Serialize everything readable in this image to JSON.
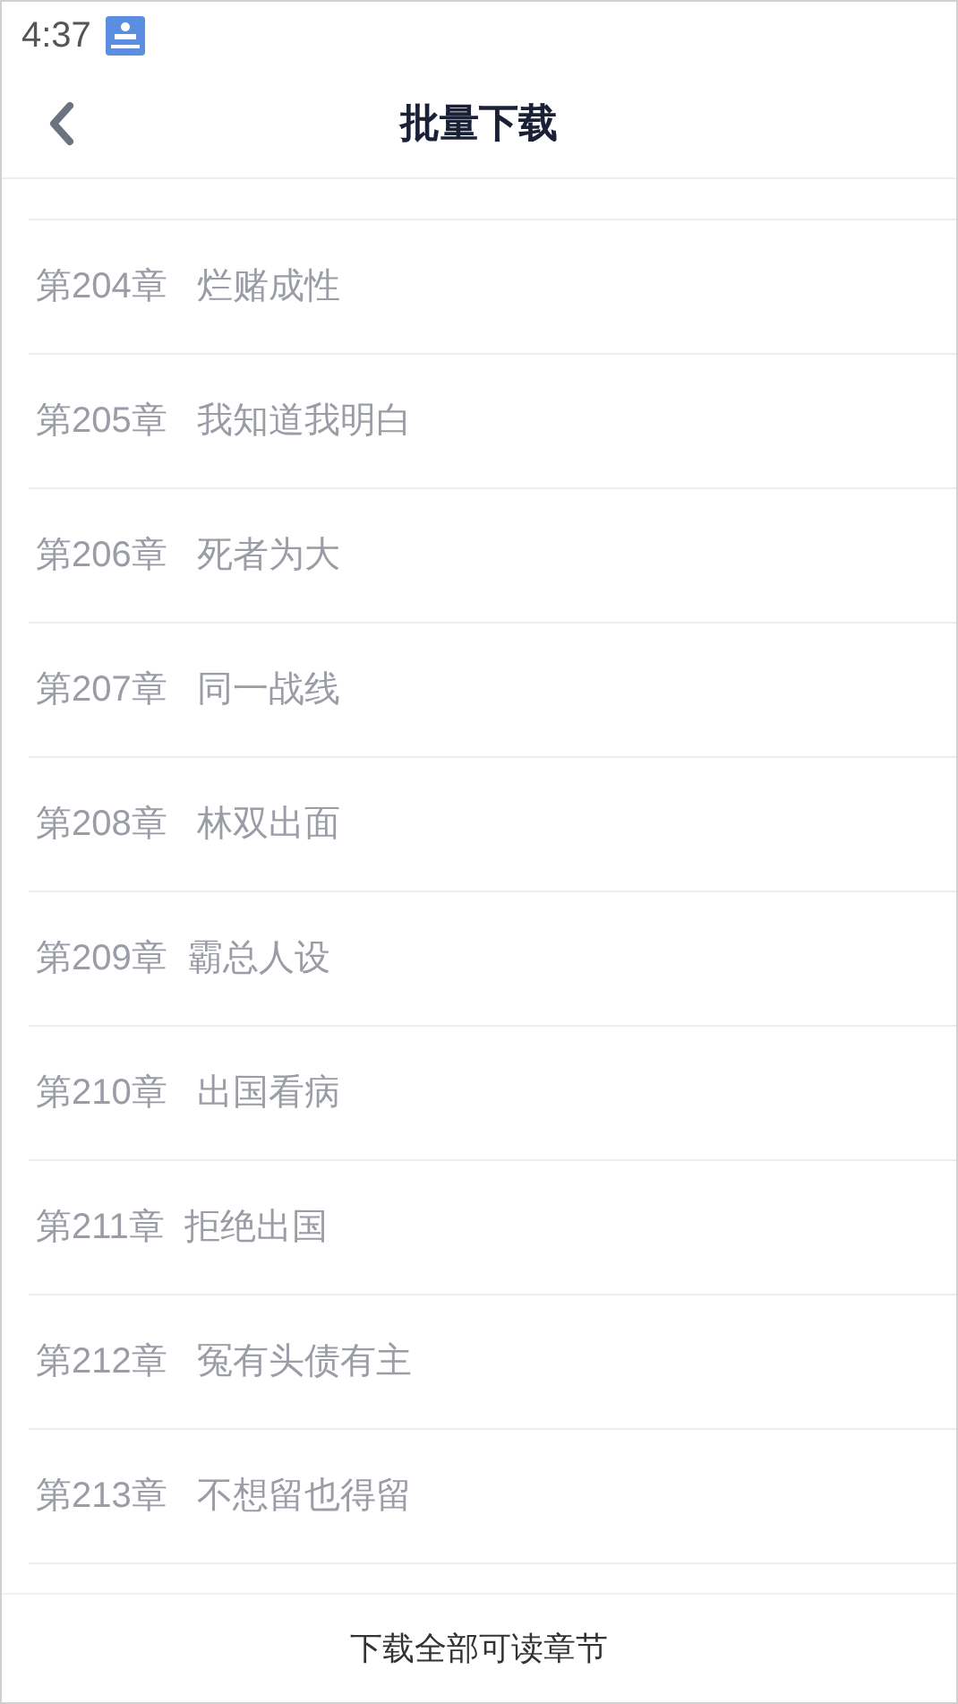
{
  "status_bar": {
    "time": "4:37"
  },
  "header": {
    "title": "批量下载"
  },
  "chapters": [
    {
      "text": "第204章   烂赌成性"
    },
    {
      "text": "第205章   我知道我明白"
    },
    {
      "text": "第206章   死者为大"
    },
    {
      "text": "第207章   同一战线"
    },
    {
      "text": "第208章   林双出面"
    },
    {
      "text": "第209章  霸总人设"
    },
    {
      "text": "第210章   出国看病"
    },
    {
      "text": "第211章  拒绝出国"
    },
    {
      "text": "第212章   冤有头债有主"
    },
    {
      "text": "第213章   不想留也得留"
    }
  ],
  "footer": {
    "button": "下载全部可读章节"
  }
}
